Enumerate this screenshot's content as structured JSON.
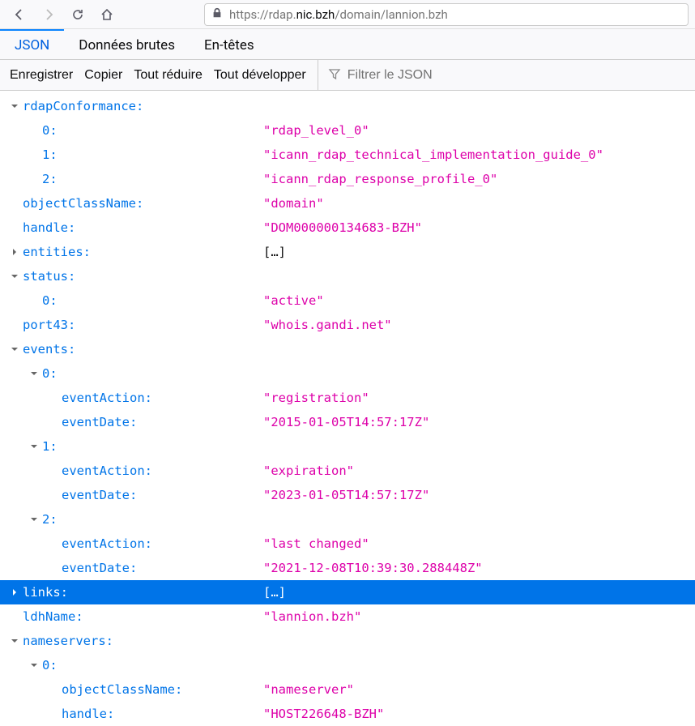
{
  "url": {
    "pre": "https://rdap.",
    "domain": "nic.bzh",
    "post": "/domain/lannion.bzh"
  },
  "tabs": {
    "json": "JSON",
    "raw": "Données brutes",
    "headers": "En-têtes"
  },
  "toolbar": {
    "save": "Enregistrer",
    "copy": "Copier",
    "collapse": "Tout réduire",
    "expand": "Tout développer",
    "filter_placeholder": "Filtrer le JSON"
  },
  "tree": {
    "rdapConformance_key": "rdapConformance:",
    "rdapConformance": {
      "k0": "0:",
      "v0": "\"rdap_level_0\"",
      "k1": "1:",
      "v1": "\"icann_rdap_technical_implementation_guide_0\"",
      "k2": "2:",
      "v2": "\"icann_rdap_response_profile_0\""
    },
    "objectClassName_key": "objectClassName:",
    "objectClassName_val": "\"domain\"",
    "handle_key": "handle:",
    "handle_val": "\"DOM000000134683-BZH\"",
    "entities_key": "entities:",
    "entities_val": "[…]",
    "status_key": "status:",
    "status": {
      "k0": "0:",
      "v0": "\"active\""
    },
    "port43_key": "port43:",
    "port43_val": "\"whois.gandi.net\"",
    "events_key": "events:",
    "events": {
      "k0": "0:",
      "e0_action_key": "eventAction:",
      "e0_action_val": "\"registration\"",
      "e0_date_key": "eventDate:",
      "e0_date_val": "\"2015-01-05T14:57:17Z\"",
      "k1": "1:",
      "e1_action_key": "eventAction:",
      "e1_action_val": "\"expiration\"",
      "e1_date_key": "eventDate:",
      "e1_date_val": "\"2023-01-05T14:57:17Z\"",
      "k2": "2:",
      "e2_action_key": "eventAction:",
      "e2_action_val": "\"last changed\"",
      "e2_date_key": "eventDate:",
      "e2_date_val": "\"2021-12-08T10:39:30.288448Z\""
    },
    "links_key": "links:",
    "links_val": "[…]",
    "ldhName_key": "ldhName:",
    "ldhName_val": "\"lannion.bzh\"",
    "nameservers_key": "nameservers:",
    "nameservers": {
      "k0": "0:",
      "ocn_key": "objectClassName:",
      "ocn_val": "\"nameserver\"",
      "handle_key": "handle:",
      "handle_val": "\"HOST226648-BZH\""
    }
  }
}
